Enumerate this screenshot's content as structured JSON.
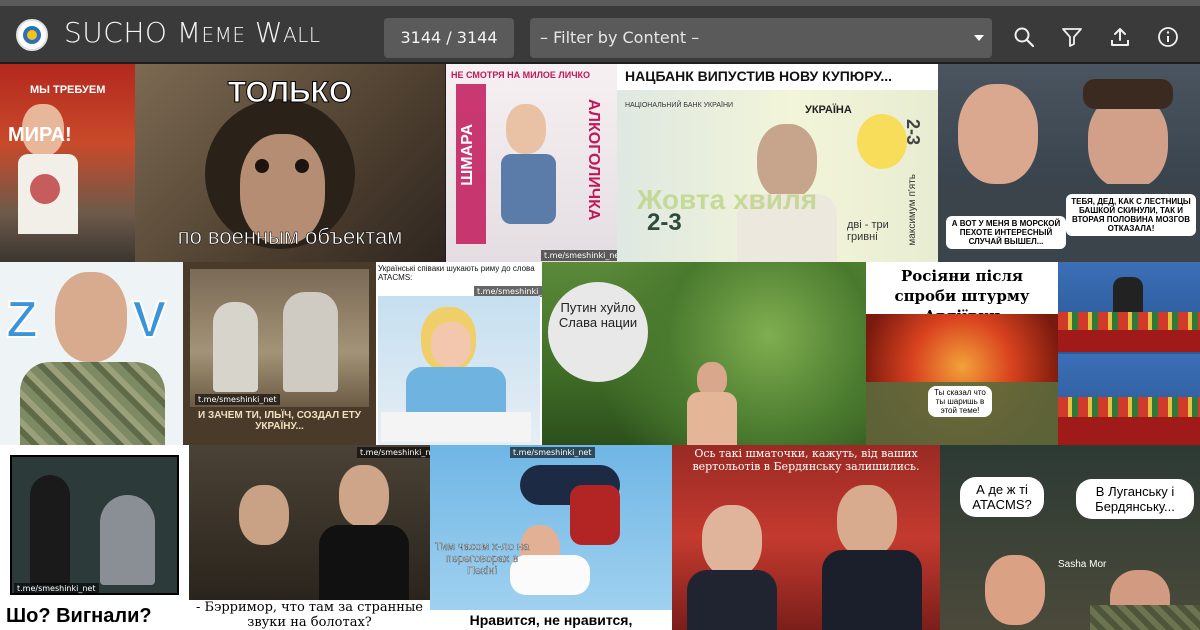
{
  "header": {
    "title": "SUCHO Meme Wall",
    "counter": "3144 / 3144",
    "filter_placeholder": "– Filter by Content –",
    "icons": [
      "search-icon",
      "filter-icon",
      "upload-icon",
      "info-icon"
    ]
  },
  "tiles": {
    "t1": {
      "text1": "МЫ ТРЕБУЕМ",
      "text2": "МИРА!"
    },
    "t2": {
      "top": "ТОЛЬКО",
      "bottom": "по военным объектам"
    },
    "t3": {
      "top": "НЕ СМОТРЯ НА МИЛОЕ ЛИЧКО",
      "side_left": "ШМАРА",
      "side_right": "АЛКОГОЛИЧКА",
      "watermark": "t.me/smeshinki_net"
    },
    "t4": {
      "top": "НАЦБАНК ВИПУСТИВ НОВУ КУПЮРУ...",
      "bank": "НАЦІОНАЛЬНИЙ БАНК УКРАЇНИ",
      "country": "УКРАЇНА",
      "denom": "2-3",
      "denom_side": "2-3",
      "words": "дві - три гривні",
      "vert": "максимум п'ять",
      "big": "Жовта хвиля"
    },
    "t5": {
      "bubble1": "А ВОТ У МЕНЯ В МОРСКОЙ ПЕХОТЕ ИНТЕРЕСНЫЙ СЛУЧАЙ ВЫШЕЛ...",
      "bubble2": "ТЕБЯ, ДЕД, КАК С ЛЕСТНИЦЫ БАШКОЙ СКИНУЛИ, ТАК И ВТОРАЯ ПОЛОВИНА МОЗГОВ ОТКАЗАЛА!"
    },
    "t6": {
      "left": "Z",
      "right": "V"
    },
    "t7": {
      "caption": "И ЗАЧЕМ ТИ, ІЛЬЇЧ, СОЗДАЛ ЕТУ УКРАЇНУ...",
      "watermark": "t.me/smeshinki_net"
    },
    "t8": {
      "caption": "Українські співаки шукають риму до слова ATACMS:",
      "watermark": "t.me/smeshinki_net"
    },
    "t9": {
      "circle": "Путин хуйло Слава нации"
    },
    "t10": {
      "top": "Росіяни після спроби штурму Авдіївки",
      "bubble": "Ты сказал что ты шаришь в этой теме!"
    },
    "t12": {
      "watermark": "t.me/smeshinki_net",
      "bottom": "Шо? Вигнали?"
    },
    "t13": {
      "watermark": "t.me/smeshinki_net",
      "caption": "- Бэрримор, что там за странные звуки на болотах?"
    },
    "t14": {
      "watermark": "t.me/smeshinki_net",
      "side": "Тим часом х-ло на переговорах в Пекіні",
      "bottom": "Нравится, не нравится,"
    },
    "t15": {
      "top": "Ось такі шматочки, кажуть, від ваших вертольотів в Бердянську залишились."
    },
    "t16": {
      "bubble1": "А де ж ті ATACMS?",
      "bubble2": "В Луганську і Бердянську...",
      "name": "Sasha Mor"
    }
  }
}
